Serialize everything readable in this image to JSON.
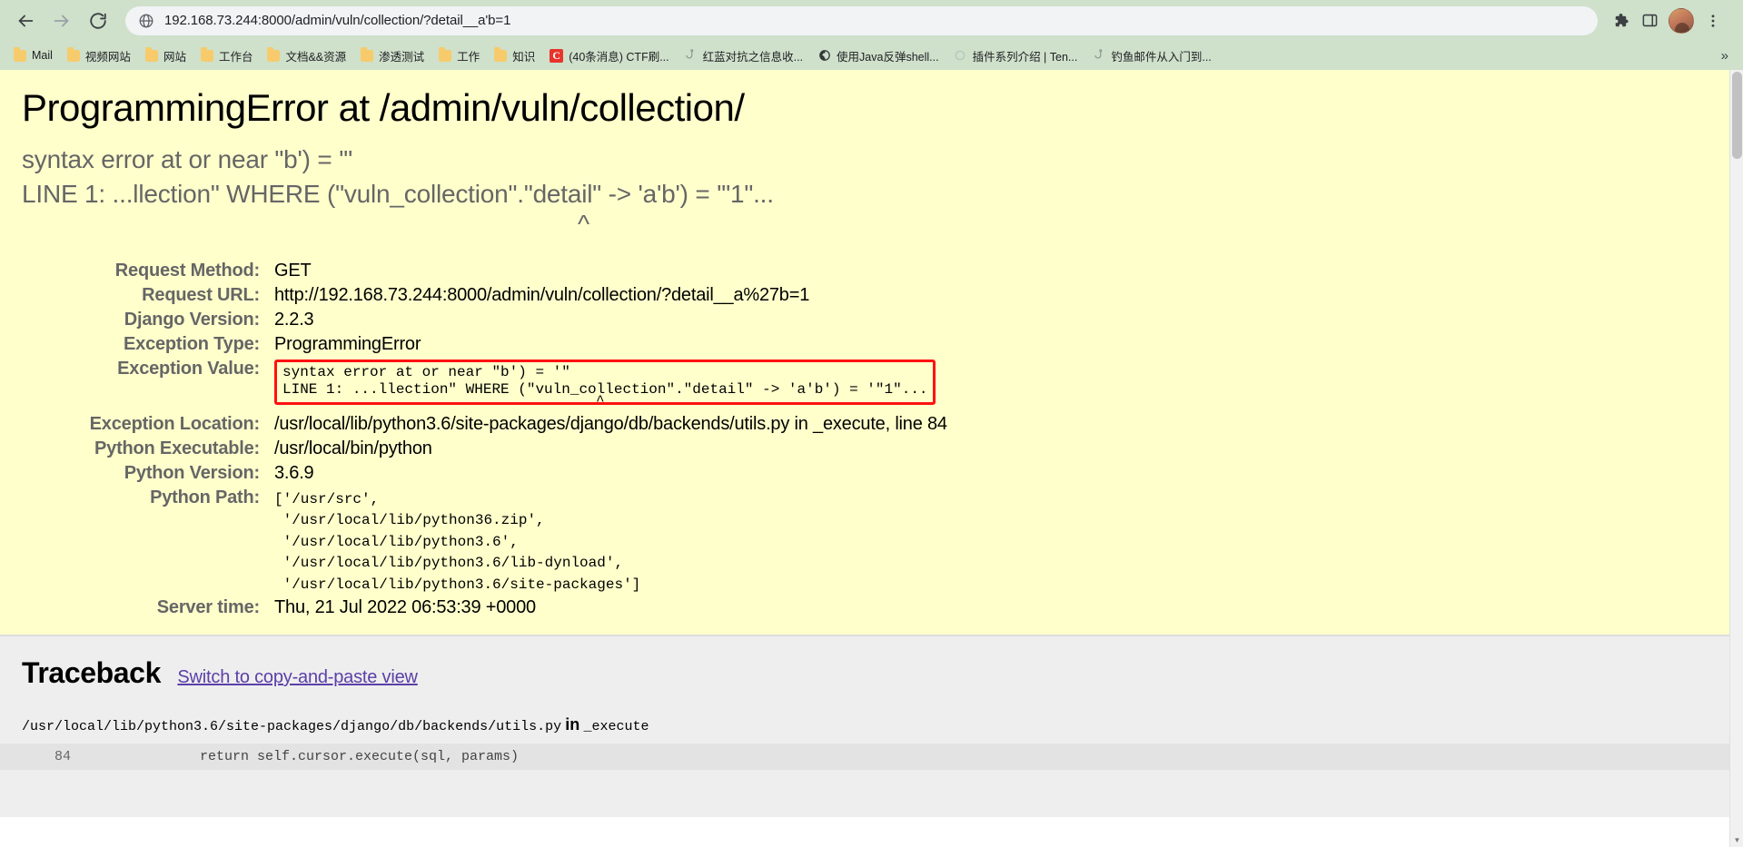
{
  "browser": {
    "nav": {
      "back_icon": "arrow-left-icon",
      "forward_icon": "arrow-right-icon",
      "reload_icon": "reload-icon"
    },
    "omnibox": {
      "site_icon": "globe-icon",
      "url": "192.168.73.244:8000/admin/vuln/collection/?detail__a'b=1"
    },
    "right_icons": [
      {
        "name": "extensions-puzzle-icon"
      },
      {
        "name": "sidepanel-icon"
      },
      {
        "name": "profile-avatar"
      },
      {
        "name": "chrome-menu-icon"
      }
    ],
    "bookmarks": [
      {
        "label": "Mail",
        "icon": "folder-icon"
      },
      {
        "label": "视频网站",
        "icon": "folder-icon"
      },
      {
        "label": "网站",
        "icon": "folder-icon"
      },
      {
        "label": "工作台",
        "icon": "folder-icon"
      },
      {
        "label": "文档&&资源",
        "icon": "folder-icon"
      },
      {
        "label": "渗透测试",
        "icon": "folder-icon"
      },
      {
        "label": "工作",
        "icon": "folder-icon"
      },
      {
        "label": "知识",
        "icon": "folder-icon"
      },
      {
        "label": "(40条消息) CTF刷...",
        "icon": "csdn-favicon"
      },
      {
        "label": "红蓝对抗之信息收...",
        "icon": "hook-favicon"
      },
      {
        "label": "使用Java反弹shell...",
        "icon": "globe-favicon"
      },
      {
        "label": "插件系列介绍 | Ten...",
        "icon": "ring-favicon"
      },
      {
        "label": "钓鱼邮件从入门到...",
        "icon": "hook-favicon"
      }
    ],
    "bookmarks_overflow": "»"
  },
  "error_page": {
    "title": "ProgrammingError at /admin/vuln/collection/",
    "summary_line1": "syntax error at or near \"b') = '\"",
    "summary_line2": "LINE 1: ...llection\" WHERE (\"vuln_collection\".\"detail\" -> 'a'b') = '\"1\"...",
    "summary_caret": "^",
    "meta": [
      {
        "label": "Request Method:",
        "value": "GET",
        "mono": false
      },
      {
        "label": "Request URL:",
        "value": "http://192.168.73.244:8000/admin/vuln/collection/?detail__a%27b=1",
        "mono": false
      },
      {
        "label": "Django Version:",
        "value": "2.2.3",
        "mono": false
      },
      {
        "label": "Exception Type:",
        "value": "ProgrammingError",
        "mono": false
      },
      {
        "label": "Exception Location:",
        "value": "/usr/local/lib/python3.6/site-packages/django/db/backends/utils.py in _execute, line 84",
        "mono": false
      },
      {
        "label": "Python Executable:",
        "value": "/usr/local/bin/python",
        "mono": false
      },
      {
        "label": "Python Version:",
        "value": "3.6.9",
        "mono": false
      }
    ],
    "exception_value": {
      "label": "Exception Value:",
      "line1": "syntax error at or near \"b') = '\"",
      "line2": "LINE 1: ...llection\" WHERE (\"vuln_collection\".\"detail\" -> 'a'b') = '\"1\"...",
      "caret": "^",
      "highlight_color": "#ff1111"
    },
    "python_path": {
      "label": "Python Path:",
      "lines": [
        "['/usr/src',",
        " '/usr/local/lib/python36.zip',",
        " '/usr/local/lib/python3.6',",
        " '/usr/local/lib/python3.6/lib-dynload',",
        " '/usr/local/lib/python3.6/site-packages']"
      ]
    },
    "server_time": {
      "label": "Server time:",
      "value": "Thu, 21 Jul 2022 06:53:39 +0000"
    },
    "traceback": {
      "heading": "Traceback",
      "switch_link": "Switch to copy-and-paste view",
      "frame_path": "/usr/local/lib/python3.6/site-packages/django/db/backends/utils.py",
      "frame_in": "in",
      "frame_function": "_execute",
      "context_line_number": "84",
      "context_code": "return self.cursor.execute(sql, params)"
    }
  },
  "colors": {
    "chrome_bg": "#cfe0cb",
    "django_header_bg": "#ffffcc",
    "traceback_bg": "#eeeeee",
    "exception_border": "#ff1111",
    "link": "#5b3fa8"
  }
}
